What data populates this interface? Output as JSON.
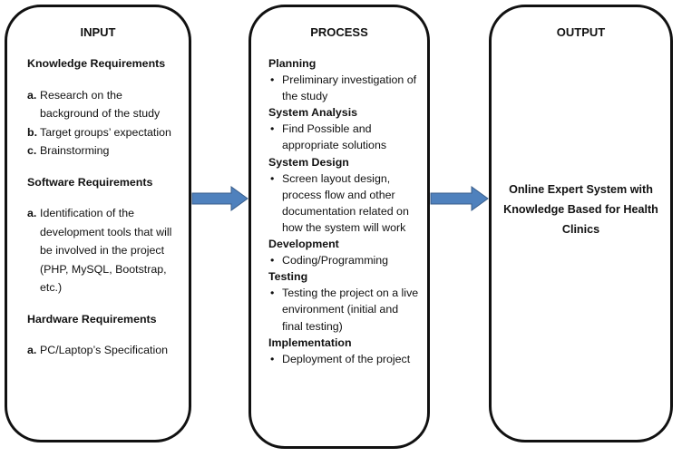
{
  "input": {
    "title": "INPUT",
    "sections": [
      {
        "title": "Knowledge Requirements",
        "items": [
          {
            "marker": "a.",
            "text": "Research on the background of the study"
          },
          {
            "marker": "b.",
            "text": "Target groups’ expectation"
          },
          {
            "marker": "c.",
            "text": "Brainstorming"
          }
        ]
      },
      {
        "title": "Software Requirements",
        "items": [
          {
            "marker": "a.",
            "text": "Identification of the development tools that will be involved in the project (PHP, MySQL, Bootstrap, etc.)"
          }
        ]
      },
      {
        "title": "Hardware Requirements",
        "items": [
          {
            "marker": "a.",
            "text": "PC/Laptop’s Specification"
          }
        ]
      }
    ]
  },
  "process": {
    "title": "PROCESS",
    "bullet": "•",
    "phases": [
      {
        "title": "Planning",
        "items": [
          "Preliminary investigation of the study"
        ]
      },
      {
        "title": "System Analysis",
        "items": [
          "Find Possible and appropriate solutions"
        ]
      },
      {
        "title": "System Design",
        "items": [
          "Screen layout design, process flow and other documentation related on how the system will work"
        ]
      },
      {
        "title": "Development",
        "items": [
          "Coding/Programming"
        ]
      },
      {
        "title": "Testing",
        "items": [
          "Testing the project on a live environment (initial and final testing)"
        ]
      },
      {
        "title": "Implementation",
        "items": [
          "Deployment of the project"
        ]
      }
    ]
  },
  "output": {
    "title": "OUTPUT",
    "result": "Online Expert System with Knowledge Based for Health Clinics"
  },
  "colors": {
    "arrow_fill": "#4f81bd",
    "arrow_stroke": "#385d8a",
    "box_border": "#111111"
  }
}
